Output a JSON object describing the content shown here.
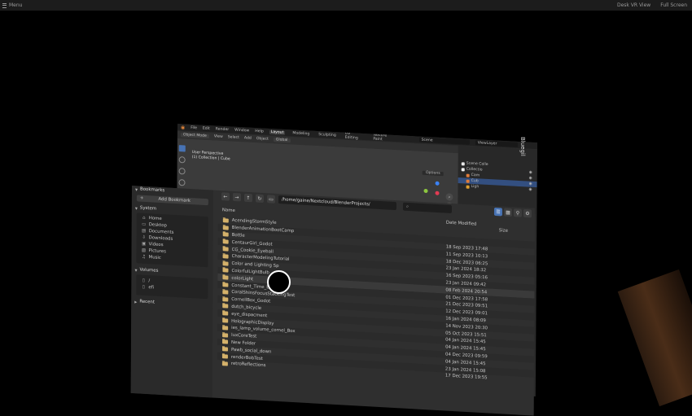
{
  "topbar": {
    "menu_label": "Menu",
    "desk_vr_view": "Desk VR View",
    "full_screen": "Full Screen"
  },
  "blender": {
    "menus": [
      "File",
      "Edit",
      "Render",
      "Window",
      "Help"
    ],
    "workspaces": [
      {
        "label": "Layout",
        "active": true
      },
      {
        "label": "Modeling",
        "active": false
      },
      {
        "label": "Sculpting",
        "active": false
      },
      {
        "label": "UV Editing",
        "active": false
      },
      {
        "label": "Texture Paint",
        "active": false
      }
    ],
    "scene": "Scene",
    "view_layer": "ViewLayer",
    "header": {
      "mode": "Object Mode",
      "view": "View",
      "select": "Select",
      "add": "Add",
      "object": "Object",
      "orientation": "Global"
    },
    "viewport": {
      "perspective": "User Perspective",
      "collection": "(1) Collection | Cube",
      "options": "Options"
    },
    "outliner": [
      {
        "label": "Scene Colle",
        "color": "#e9e9e9",
        "selected": false
      },
      {
        "label": "Collectio",
        "color": "#f2f2f2",
        "selected": false
      },
      {
        "label": "Cam",
        "color": "#e07b39",
        "selected": false
      },
      {
        "label": "Cub",
        "color": "#e07b39",
        "selected": true
      },
      {
        "label": "Ligh",
        "color": "#e0a030",
        "selected": false
      }
    ],
    "side_text": "Bluegil"
  },
  "filebrowser": {
    "bookmarks_title": "Bookmarks",
    "add_bookmark": "Add Bookmark",
    "system_title": "System",
    "system_items": [
      {
        "label": "Home",
        "icon": "home-icon"
      },
      {
        "label": "Desktop",
        "icon": "desktop-icon"
      },
      {
        "label": "Documents",
        "icon": "documents-icon"
      },
      {
        "label": "Downloads",
        "icon": "download-icon"
      },
      {
        "label": "Videos",
        "icon": "video-icon"
      },
      {
        "label": "Pictures",
        "icon": "picture-icon"
      },
      {
        "label": "Music",
        "icon": "music-icon"
      }
    ],
    "volumes_title": "Volumes",
    "volume_items": [
      "/",
      "efi"
    ],
    "recent_title": "Recent",
    "path": "/home/gaine/Nextcloud/BlenderProjects/",
    "columns": {
      "name": "Name",
      "date": "Date Modified",
      "size": "Size"
    },
    "files": [
      {
        "name": "AcendingStormStyle",
        "date": ""
      },
      {
        "name": "BlenderAnimationBootCamp",
        "date": ""
      },
      {
        "name": "Bottle",
        "date": "18 Sep 2023 17:48"
      },
      {
        "name": "CentaurGirl_Godot",
        "date": "11 Sep 2023 10:13"
      },
      {
        "name": "CG_Cookie_Eyeball",
        "date": "18 Dec 2023 06:25"
      },
      {
        "name": "CharacterModelingTutorial",
        "date": "23 Jan 2024 18:32"
      },
      {
        "name": "Color and Lighting Sp",
        "date": "16 Sep 2023 05:16"
      },
      {
        "name": "ColorfulLightBulb",
        "date": "23 Jan 2024 09:42"
      },
      {
        "name": "colorLight",
        "date": "08 Feb 2024 20:54"
      },
      {
        "name": "Constant_Time_Eye_Mod",
        "date": "01 Dec 2023 17:58"
      },
      {
        "name": "CoralShinsFocusStackingTest",
        "date": "21 Dec 2023 09:51"
      },
      {
        "name": "CornellBox_Godot",
        "date": "12 Dec 2023 09:01"
      },
      {
        "name": "dutch_bicycle",
        "date": "16 Jan 2024 08:09"
      },
      {
        "name": "eye_dispacment",
        "date": "14 Nov 2023 20:30"
      },
      {
        "name": "HolographicDisplay",
        "date": "05 Oct 2023 15:51"
      },
      {
        "name": "ies_lamp_volume_cornel_Box",
        "date": "04 Jan 2024 15:45"
      },
      {
        "name": "luxCoreTest",
        "date": "04 Jan 2024 15:45"
      },
      {
        "name": "New Folder",
        "date": "04 Dec 2023 09:59"
      },
      {
        "name": "Pawb_social_down",
        "date": "04 Jan 2024 15:45"
      },
      {
        "name": "renderBobTest",
        "date": "23 Jan 2024 15:08"
      },
      {
        "name": "retroReflections",
        "date": "17 Dec 2023 19:55"
      }
    ]
  }
}
